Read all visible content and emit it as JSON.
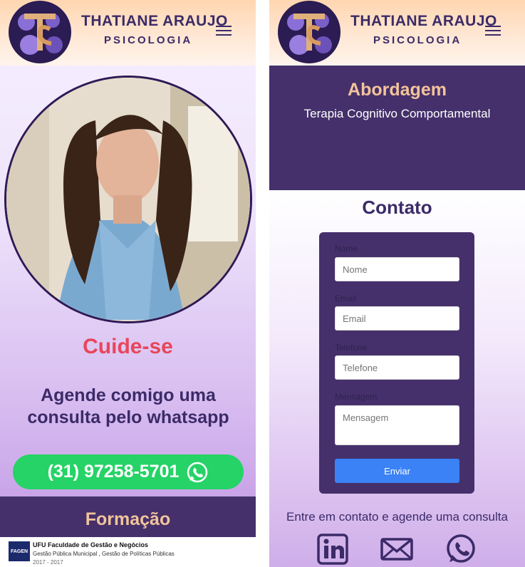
{
  "brand": {
    "name": "THATIANE ARAUJO",
    "sub": "PSICOLOGIA"
  },
  "hero": {
    "title": "Cuide-se",
    "subtitle": "Agende comigo uma consulta pelo whatsapp",
    "phone": "(31) 97258-5701"
  },
  "formacao": {
    "title": "Formação",
    "item": {
      "logo_text": "FAGEN",
      "institution": "UFU Faculdade de Gestão e Negócios",
      "course": "Gestão Pública Municipal , Gestão de Políticas Públicas",
      "years": "2017 - 2017"
    }
  },
  "abordagem": {
    "title": "Abordagem",
    "text": "Terapia Cognitivo Comportamental"
  },
  "contato": {
    "title": "Contato",
    "fields": [
      {
        "label": "Nome",
        "placeholder": "Nome"
      },
      {
        "label": "Email",
        "placeholder": "Email"
      },
      {
        "label": "Telefone",
        "placeholder": "Telefone"
      },
      {
        "label": "Mensagem",
        "placeholder": "Mensagem"
      }
    ],
    "submit": "Enviar",
    "cta": "Entre em contato e agende uma consulta"
  },
  "icons": [
    "menu-icon",
    "whatsapp-icon",
    "linkedin-icon",
    "mail-icon"
  ],
  "colors": {
    "primary": "#45306b",
    "accent": "#e8465a",
    "gold": "#f2c49a",
    "whatsapp": "#25d366",
    "button": "#3b82f6"
  }
}
